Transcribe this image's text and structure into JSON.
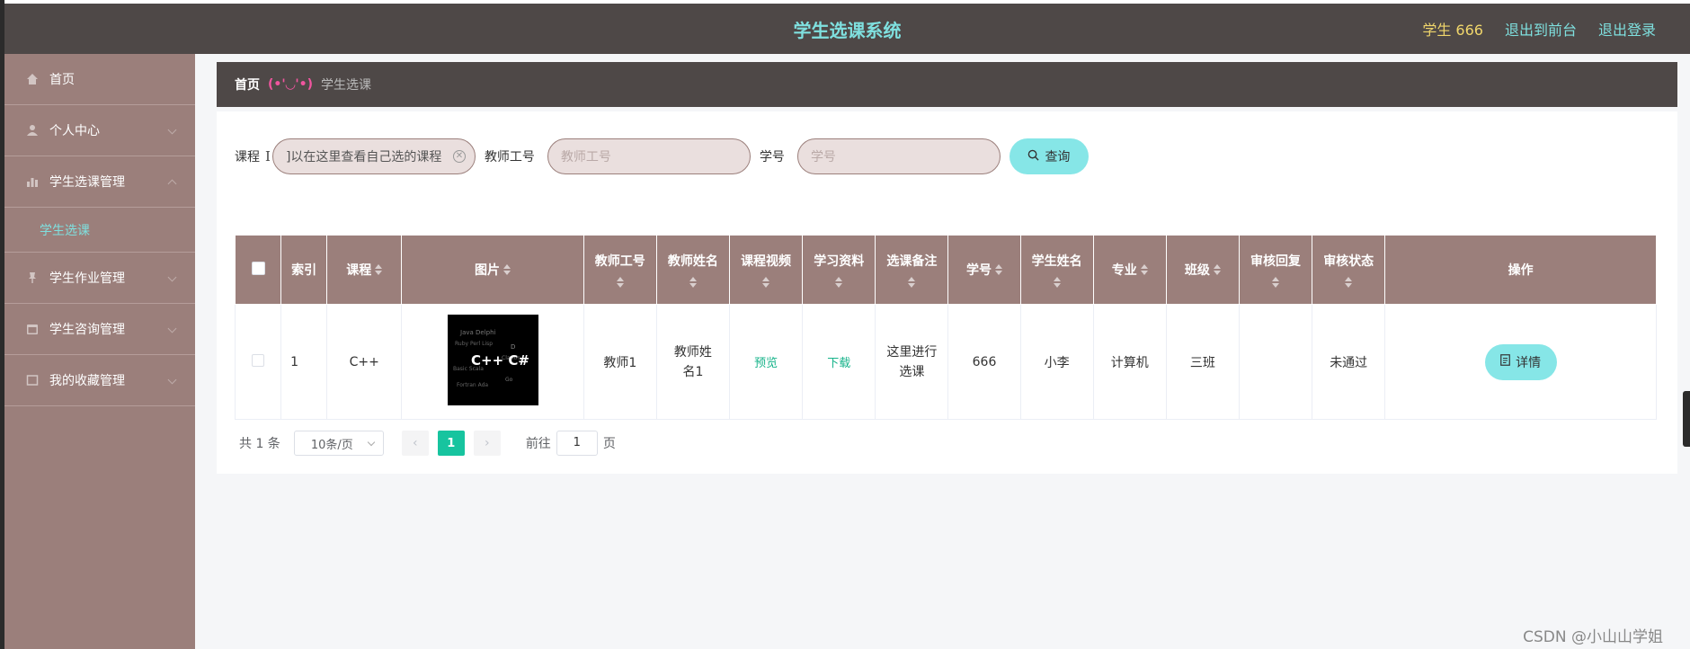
{
  "header": {
    "title": "学生选课系统",
    "user_label": "学生 666",
    "links": [
      "退出到前台",
      "退出登录"
    ]
  },
  "sidebar": {
    "items": [
      {
        "label": "首页",
        "icon": "home-icon"
      },
      {
        "label": "个人中心",
        "icon": "user-icon"
      },
      {
        "label": "学生选课管理",
        "icon": "chart-icon"
      },
      {
        "label": "学生作业管理",
        "icon": "pin-icon"
      },
      {
        "label": "学生咨询管理",
        "icon": "calendar-icon"
      },
      {
        "label": "我的收藏管理",
        "icon": "box-icon"
      }
    ],
    "submenu": {
      "label": "学生选课"
    }
  },
  "breadcrumb": {
    "home": "首页",
    "separator": "(•'◡'•)",
    "current": "学生选课"
  },
  "search": {
    "course_label": "课程",
    "course_value": "]以在这里查看自己选的课程",
    "teacher_label": "教师工号",
    "teacher_placeholder": "教师工号",
    "student_label": "学号",
    "student_placeholder": "学号",
    "button": "查询"
  },
  "table": {
    "headers": [
      "索引",
      "课程",
      "图片",
      "教师工号",
      "教师姓名",
      "课程视频",
      "学习资料",
      "选课备注",
      "学号",
      "学生姓名",
      "专业",
      "班级",
      "审核回复",
      "审核状态",
      "操作"
    ],
    "rows": [
      {
        "index": "1",
        "course": "C++",
        "image_text": "C++ C#",
        "teacher_id": "教师1",
        "teacher_name": "教师姓名1",
        "video": "预览",
        "material": "下载",
        "note": "这里进行选课",
        "student_id": "666",
        "student_name": "小李",
        "major": "计算机",
        "class": "三班",
        "reply": "",
        "status": "未通过",
        "action": "详情"
      }
    ]
  },
  "pagination": {
    "total": "共 1 条",
    "page_size": "10条/页",
    "current_page": "1",
    "goto_label": "前往",
    "goto_value": "1",
    "page_suffix": "页"
  },
  "watermark": "CSDN @小山山学姐",
  "colors": {
    "header_bg": "#4e4847",
    "sidebar_bg": "#9b7f7b",
    "accent": "#7fe0df",
    "button": "#86e6e7",
    "user_label": "#f0d66b",
    "active_page": "#17c49f"
  }
}
